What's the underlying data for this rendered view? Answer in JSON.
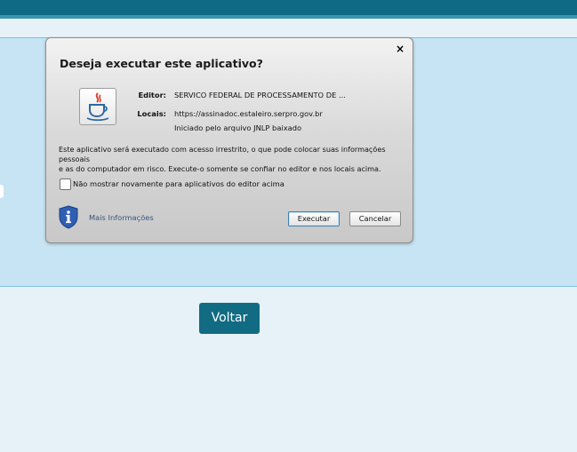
{
  "dialog": {
    "close_symbol": "×",
    "title": "Deseja executar este aplicativo?",
    "app_icon": "java-icon",
    "editor_label": "Editor:",
    "editor_value": "SERVICO FEDERAL DE PROCESSAMENTO DE ...",
    "locais_label": "Locais:",
    "locais_value": "https://assinadoc.estaleiro.serpro.gov.br",
    "locais_note": "Iniciado pelo arquivo JNLP baixado",
    "warning_line1": "Este aplicativo será executado com acesso irrestrito, o que pode colocar suas informações pessoais",
    "warning_line2": "e as do computador em risco. Execute-o somente se confiar no editor e nos locais acima.",
    "checkbox_label": "Não mostrar novamente para aplicativos do editor acima",
    "checkbox_checked": false,
    "more_info": "Mais Informações",
    "execute_label": "Executar",
    "cancel_label": "Cancelar"
  },
  "page": {
    "back_label": "Voltar"
  },
  "colors": {
    "topbar": "#0e6a85",
    "panel": "#c6e4f3",
    "background": "#e6f2f7",
    "back_button": "#116b83"
  }
}
